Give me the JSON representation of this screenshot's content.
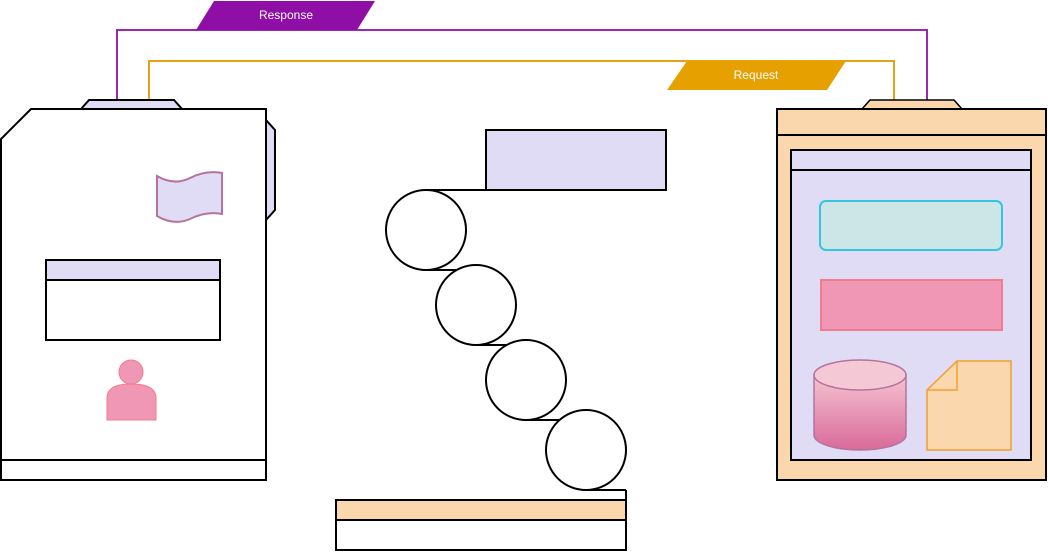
{
  "connectors": {
    "response": {
      "label": "Response",
      "color": "#8e0ea6",
      "line_color": "#9c27b0"
    },
    "request": {
      "label": "Request",
      "color": "#e6a000",
      "line_color": "#e6a117"
    }
  },
  "colors": {
    "outline": "#000000",
    "lavender": "#e0dcf5",
    "peach": "#fad7ac",
    "pink": "#f197b6",
    "pink_stroke": "#f07c8c",
    "teal_fill": "#cce5e6",
    "teal_stroke": "#33c6e0",
    "mauve_stroke": "#b5739d",
    "doc_stroke": "#f0a030"
  },
  "icons": {
    "client_device": "device-icon",
    "flag": "flag-icon",
    "user": "user-icon",
    "database": "database-icon",
    "note": "note-icon",
    "server_window": "server-window-icon",
    "pipeline": "roller-chain-icon"
  }
}
